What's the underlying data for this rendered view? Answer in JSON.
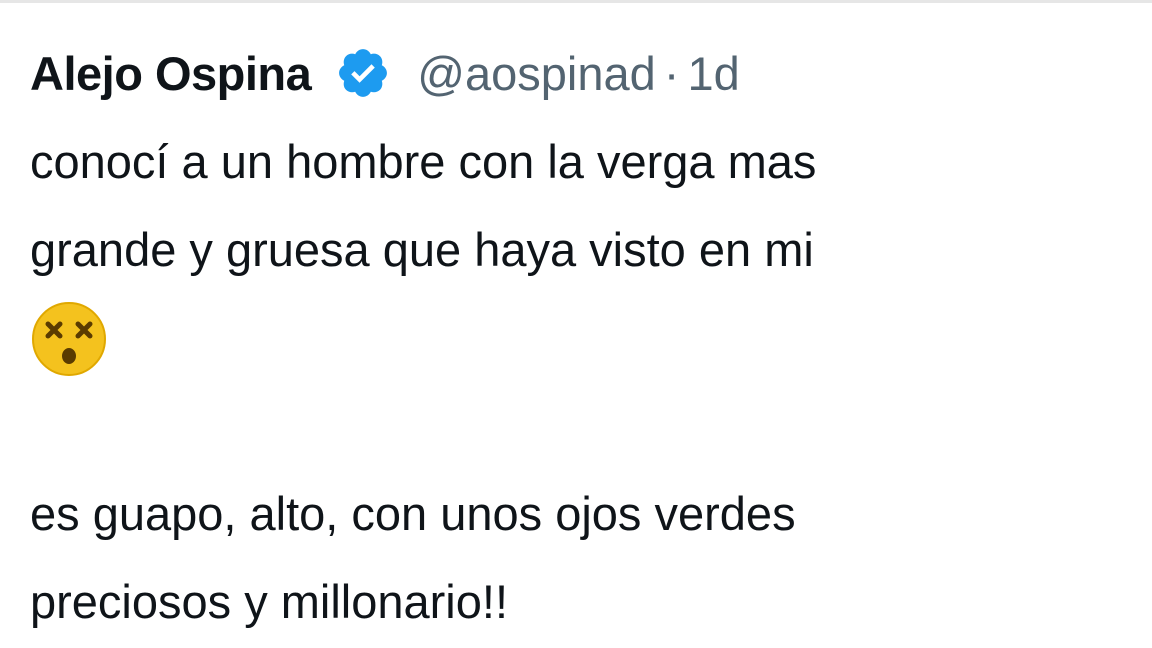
{
  "tweet": {
    "author": {
      "display_name": "Alejo Ospina",
      "handle": "@aospinad",
      "separator": "·",
      "time": "1d",
      "verified_icon": "verified-badge-icon",
      "verified_color": "#1d9bf0"
    },
    "lines": [
      "conocí a un hombre con la verga mas",
      "grande y gruesa que haya visto en mi",
      "es guapo, alto, con unos ojos verdes",
      "preciosos y millonario!!"
    ],
    "emoji": "face-with-crossed-out-eyes-icon"
  },
  "colors": {
    "text": "#0f1419",
    "secondary": "#536471",
    "emoji_yellow": "#f4c21e"
  }
}
